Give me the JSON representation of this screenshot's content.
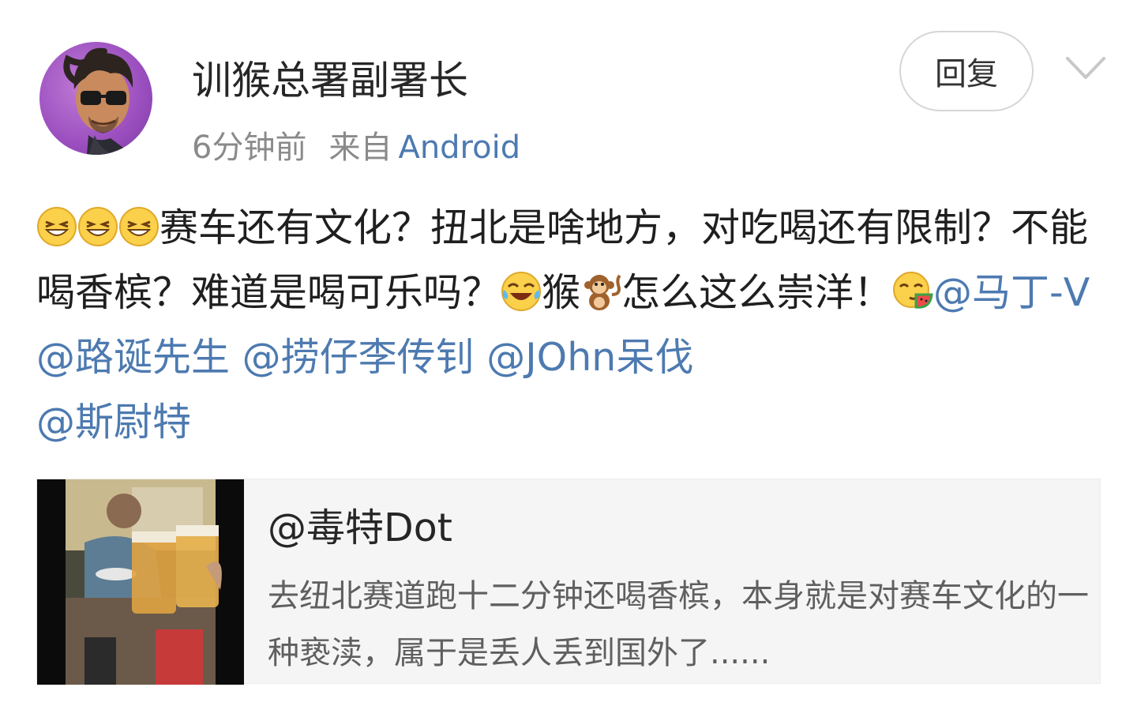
{
  "user": {
    "name": "训猴总署副署长",
    "time": "6分钟前",
    "source_label": "来自",
    "source_device": "Android"
  },
  "actions": {
    "reply_label": "回复",
    "more_icon": "chevron-down-icon"
  },
  "post": {
    "text_1": "赛车还有文化？扭北是啥地方，对吃喝还有限制？不能喝香槟？难道是喝可乐吗？",
    "text_2": "猴",
    "text_3": "怎么这么崇洋！",
    "mentions": [
      "@马丁-V",
      "@路诞先生",
      "@捞仔李传钊",
      "@JOhn呆伐",
      "@斯尉特"
    ],
    "emojis": [
      "grin-emoji",
      "grin-emoji",
      "grin-emoji",
      "laugh-cry-emoji",
      "monkey-emoji",
      "yum-watermelon-emoji"
    ]
  },
  "quoted": {
    "author": "@毒特Dot",
    "text": "去纽北赛道跑十二分钟还喝香槟，本身就是对赛车文化的一种亵渎，属于是丢人丢到国外了......"
  },
  "colors": {
    "link": "#4d7ab0",
    "meta": "#8a8a8a",
    "card_bg": "#f5f5f5"
  }
}
